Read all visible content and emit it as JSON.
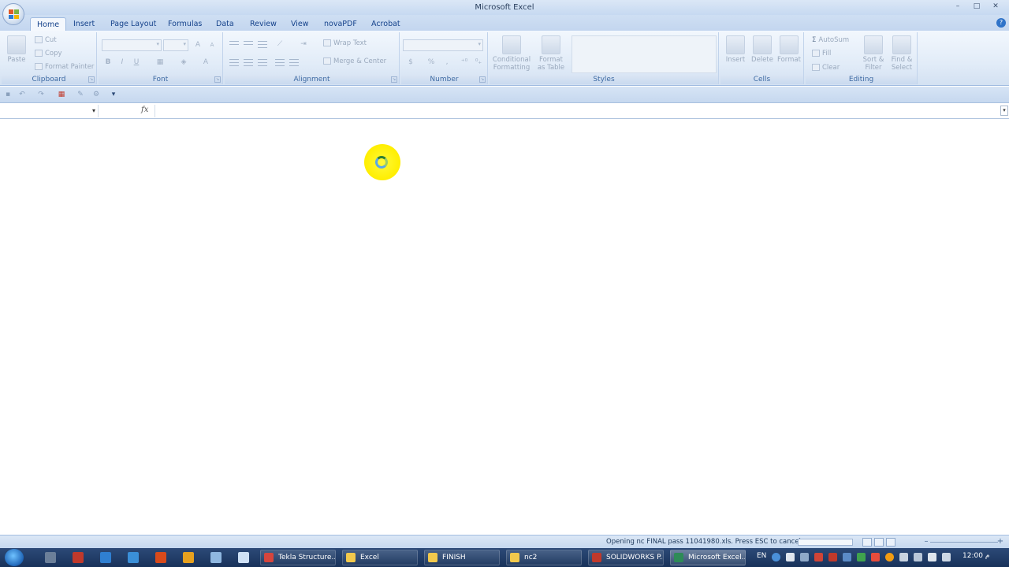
{
  "window": {
    "title": "Microsoft Excel",
    "min": "–",
    "max": "□",
    "close": "✕"
  },
  "tabs": [
    "Home",
    "Insert",
    "Page Layout",
    "Formulas",
    "Data",
    "Review",
    "View",
    "novaPDF",
    "Acrobat"
  ],
  "help": "?",
  "ribbon": {
    "clipboard": {
      "label": "Clipboard",
      "paste": "Paste",
      "cut": "Cut",
      "copy": "Copy",
      "format_painter": "Format Painter"
    },
    "font": {
      "label": "Font",
      "bold": "B",
      "italic": "I",
      "underline": "U",
      "grow": "A",
      "shrink": "A",
      "color": "A"
    },
    "alignment": {
      "label": "Alignment",
      "wrap_text": "Wrap Text",
      "merge_center": "Merge & Center"
    },
    "number": {
      "label": "Number",
      "percent": "%",
      "comma": ",",
      "currency": "$"
    },
    "styles": {
      "label": "Styles",
      "conditional_1": "Conditional",
      "conditional_2": "Formatting",
      "format_table_1": "Format",
      "format_table_2": "as Table"
    },
    "cells": {
      "label": "Cells",
      "insert": "Insert",
      "delete": "Delete",
      "format": "Format"
    },
    "editing": {
      "label": "Editing",
      "autosum": "AutoSum",
      "fill": "Fill",
      "clear": "Clear",
      "sort_1": "Sort &",
      "sort_2": "Filter",
      "find_1": "Find &",
      "find_2": "Select",
      "sigma": "Σ"
    }
  },
  "formula_bar": {
    "fx": "fx",
    "namebox_arrow": "▾",
    "expand": "▾"
  },
  "status": {
    "text": "Opening nc FINAL pass  11041980.xls. Press ESC to cancel.",
    "progress": 0
  },
  "taskbar": {
    "tasks": [
      "Tekla Structure...",
      "Excel",
      "FINISH",
      "nc2",
      "SOLIDWORKS P...",
      "Microsoft Excel..."
    ],
    "lang": "EN",
    "clock": "12:00 م"
  },
  "colors": {
    "accent": "#15428b",
    "highlight": "#ffee00",
    "taskbar": "#18325a"
  }
}
